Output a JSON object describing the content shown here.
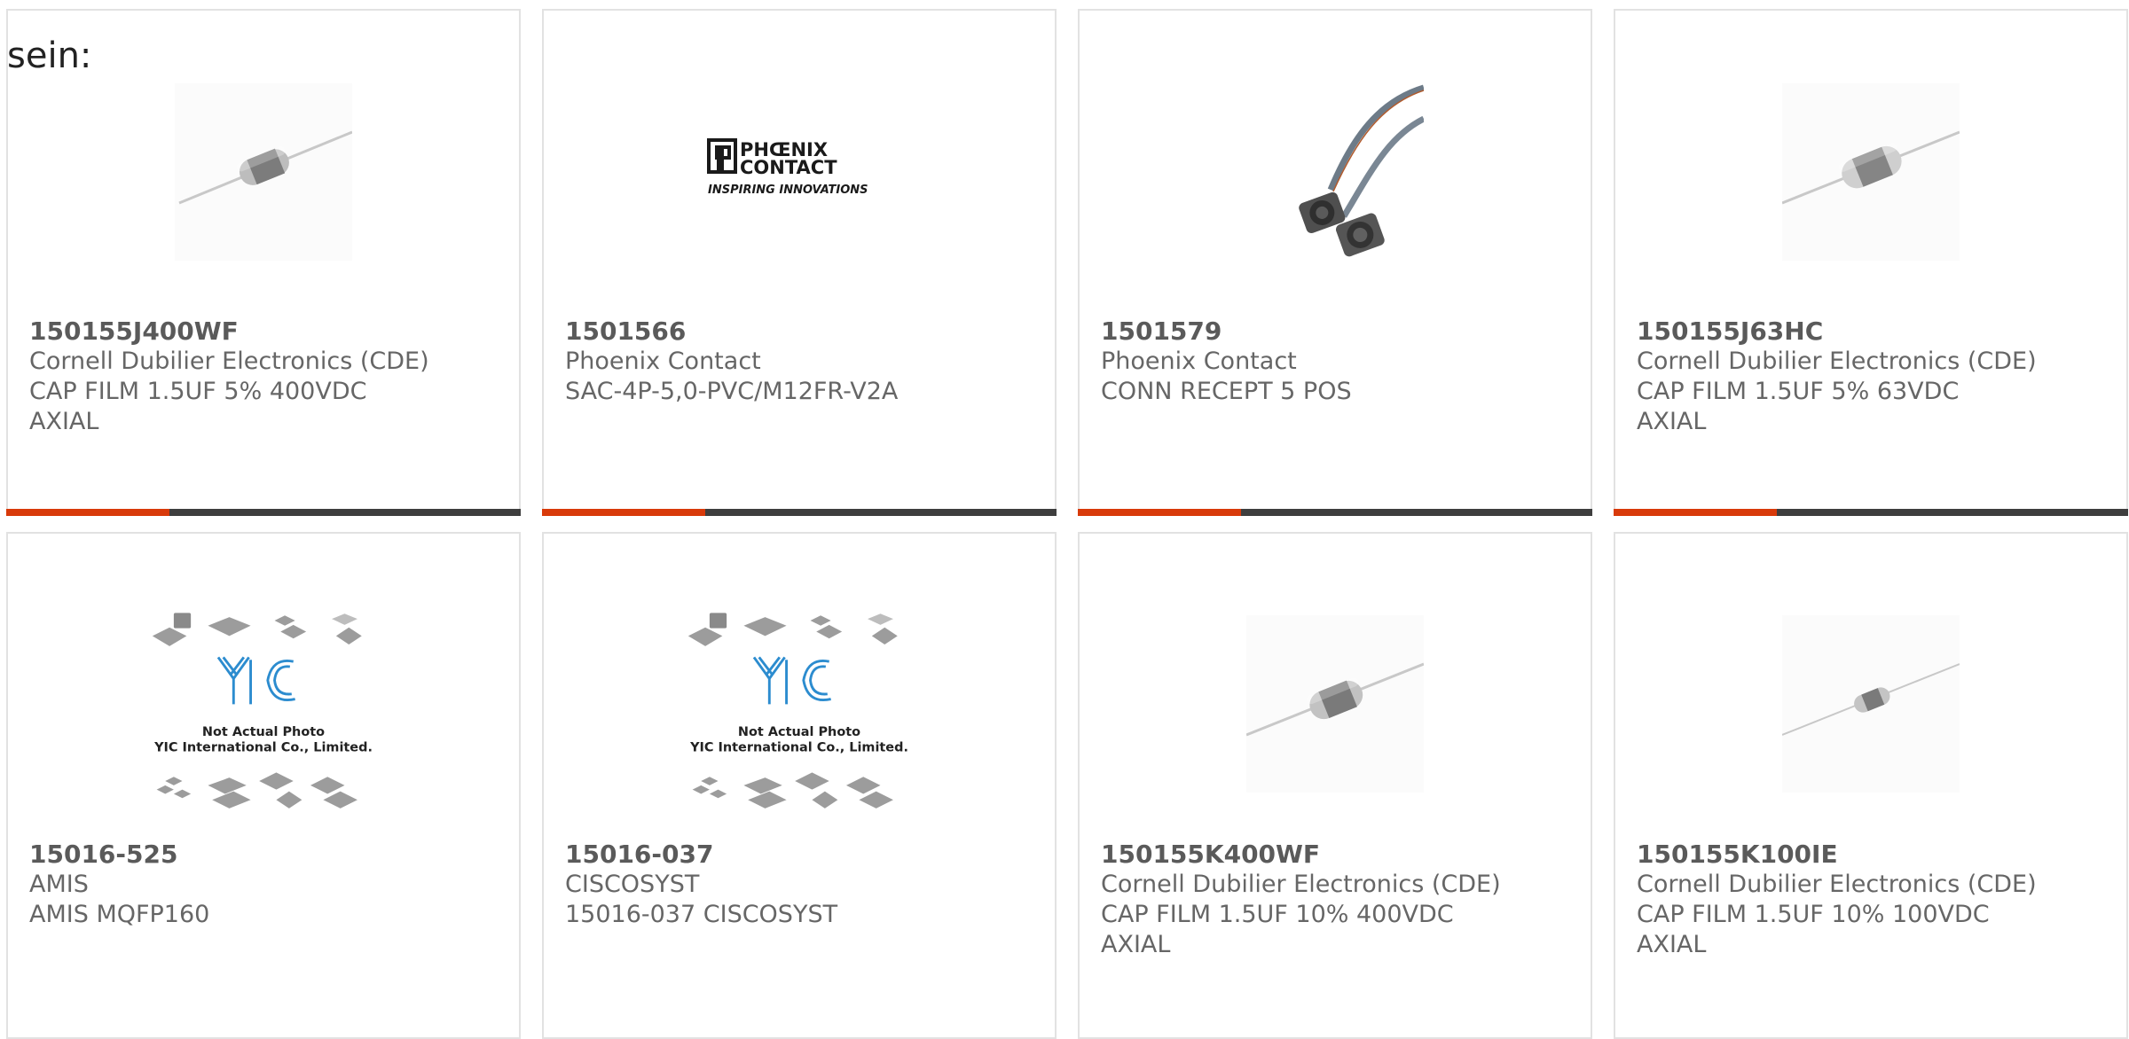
{
  "lead_text": "sein:",
  "colors": {
    "accent": "#d83a0a",
    "bar": "#3e3e3e",
    "border": "#e2e2e2"
  },
  "products": [
    {
      "part": "150155J400WF",
      "manufacturer": "Cornell Dubilier Electronics (CDE)",
      "desc1": "CAP FILM 1.5UF 5% 400VDC",
      "desc2": "AXIAL",
      "image": "axial-capacitor-icon"
    },
    {
      "part": "1501566",
      "manufacturer": "Phoenix Contact",
      "desc1": "SAC-4P-5,0-PVC/M12FR-V2A",
      "desc2": "",
      "image": "phoenix-contact-logo",
      "logo_line1": "PHŒNIX",
      "logo_line2": "CONTACT",
      "logo_tag": "INSPIRING INNOVATIONS"
    },
    {
      "part": "1501579",
      "manufacturer": "Phoenix Contact",
      "desc1": "CONN RECEPT 5 POS",
      "desc2": "",
      "image": "m12-connector-cable-icon"
    },
    {
      "part": "150155J63HC",
      "manufacturer": "Cornell Dubilier Electronics (CDE)",
      "desc1": "CAP FILM 1.5UF 5% 63VDC",
      "desc2": "AXIAL",
      "image": "axial-capacitor-icon"
    },
    {
      "part": "15016-525",
      "manufacturer": "AMIS",
      "desc1": "AMIS MQFP160",
      "desc2": "",
      "image": "yic-placeholder-icon",
      "ph_line1": "Not Actual Photo",
      "ph_line2": "YIC International Co., Limited."
    },
    {
      "part": "15016-037",
      "manufacturer": "CISCOSYST",
      "desc1": "15016-037 CISCOSYST",
      "desc2": "",
      "image": "yic-placeholder-icon",
      "ph_line1": "Not Actual Photo",
      "ph_line2": "YIC International Co., Limited."
    },
    {
      "part": "150155K400WF",
      "manufacturer": "Cornell Dubilier Electronics (CDE)",
      "desc1": "CAP FILM 1.5UF 10% 400VDC",
      "desc2": "AXIAL",
      "image": "axial-capacitor-icon"
    },
    {
      "part": "150155K100IE",
      "manufacturer": "Cornell Dubilier Electronics (CDE)",
      "desc1": "CAP FILM 1.5UF 10% 100VDC",
      "desc2": "AXIAL",
      "image": "axial-capacitor-small-icon"
    }
  ]
}
